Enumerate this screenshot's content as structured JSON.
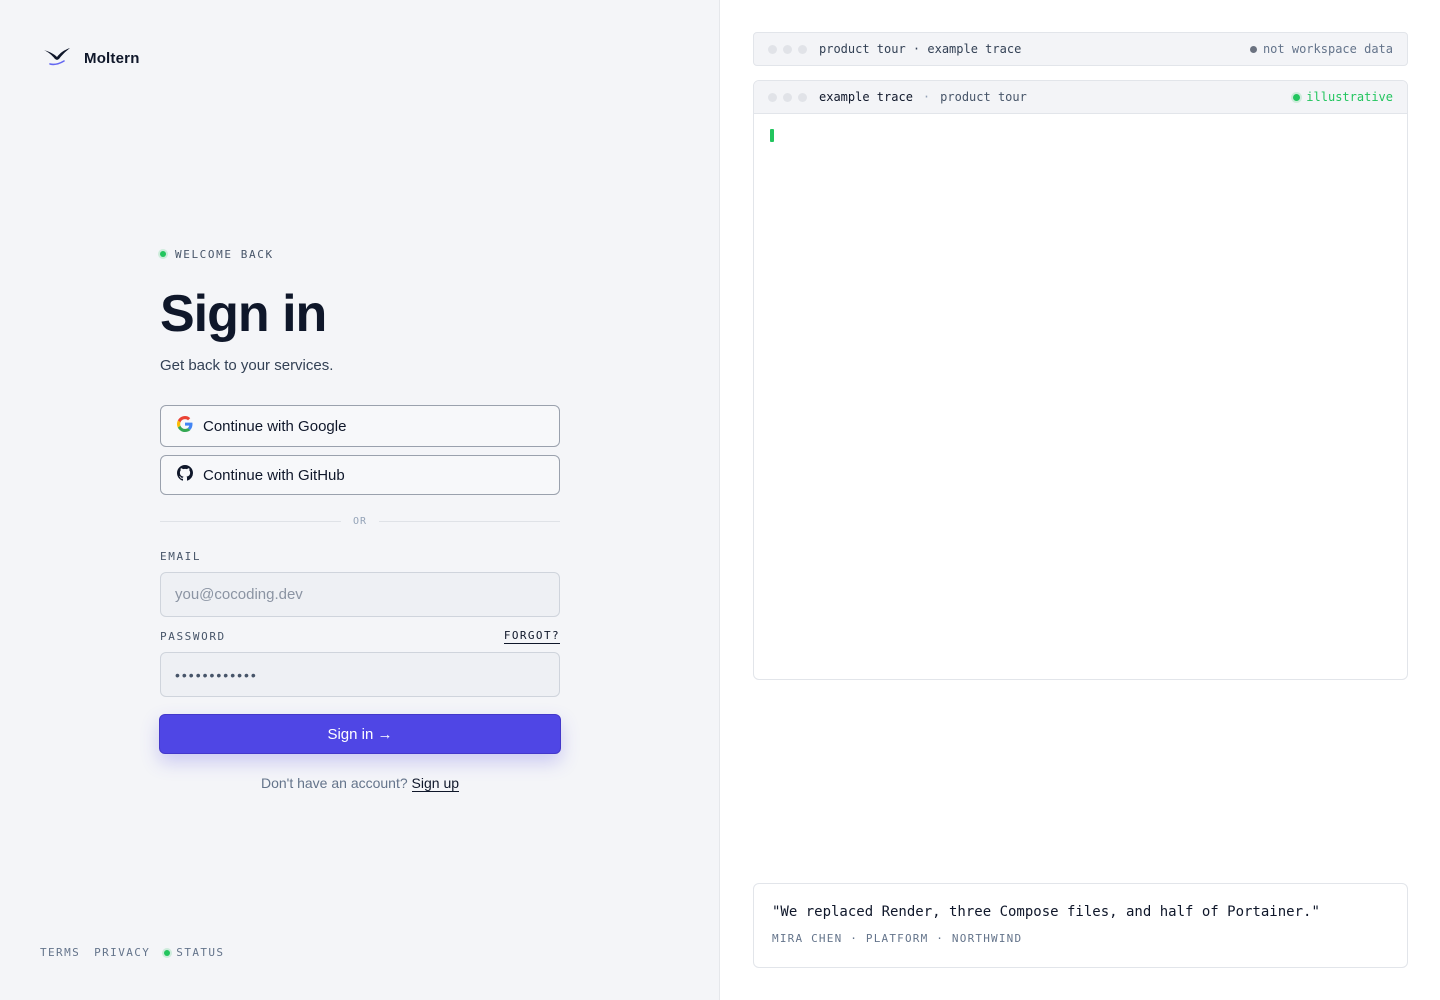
{
  "brand": {
    "name": "Moltern",
    "icon": "bird-logo-icon"
  },
  "auth": {
    "eyebrow": "WELCOME BACK",
    "title": "Sign in",
    "subtitle": "Get back to your services.",
    "google_label": "Continue with Google",
    "github_label": "Continue with GitHub",
    "or_text": "OR",
    "email_label": "EMAIL",
    "email_placeholder": "you@cocoding.dev",
    "password_label": "PASSWORD",
    "forgot_label": "FORGOT?",
    "password_value": "••••••••••••",
    "signin_label": "Sign in →",
    "signup_prompt": "Don't have an account?",
    "signup_link": "Sign up"
  },
  "footer": {
    "terms": "TERMS",
    "privacy": "PRIVACY",
    "status": "STATUS"
  },
  "tour_bar": {
    "title": "product tour · example trace",
    "badge": "not workspace data"
  },
  "trace_panel": {
    "title": "example trace",
    "separator": "·",
    "subtitle": "product tour",
    "badge": "illustrative"
  },
  "testimonial": {
    "quote": "\"We replaced Render, three Compose files, and half of Portainer.\"",
    "attribution": "MIRA CHEN · PLATFORM · NORTHWIND"
  },
  "colors": {
    "accent": "#4f46e5",
    "status_green": "#22c55e",
    "panel_bg": "#f4f5f8"
  }
}
